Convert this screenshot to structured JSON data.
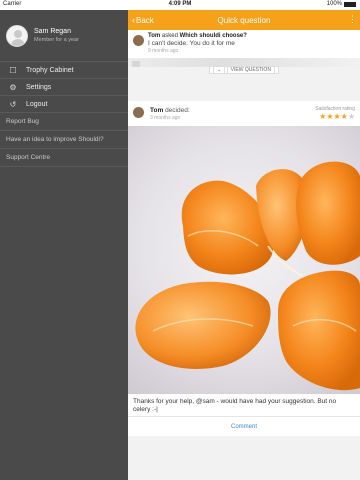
{
  "status_bar": {
    "carrier": "Carrier",
    "time": "4:09 PM",
    "battery": "100%"
  },
  "drawer": {
    "profile": {
      "name": "Sam Regan",
      "subtitle": "Member for a year"
    },
    "menu": [
      {
        "icon": "trophy-icon",
        "label": "Trophy Cabinet"
      },
      {
        "icon": "gear-icon",
        "label": "Settings"
      },
      {
        "icon": "logout-icon",
        "label": "Logout"
      }
    ],
    "links": [
      "Report Bug",
      "Have an idea to improve Shouldi?",
      "Support Centre"
    ]
  },
  "nav": {
    "back_label": "Back",
    "title": "Quick question",
    "more_icon": "more-vertical-icon"
  },
  "question": {
    "author": "Tom",
    "verb": "asked",
    "question": "Which shouldi choose?",
    "body": "I can't decide. You do it for me",
    "time": "9 months ago",
    "view_label": "VIEW QUESTION"
  },
  "decision": {
    "author": "Tom",
    "verb": "decided:",
    "time": "3 months ago",
    "satisfaction_label": "Satisfaction rating",
    "rating": 4,
    "rating_max": 5,
    "caption": "Thanks for your help, @sam - would have had your suggestion. But no celery :-|",
    "comment_label": "Comment"
  },
  "colors": {
    "accent": "#f5a21a",
    "drawer": "#4a4a4a",
    "link": "#3d88d3"
  }
}
